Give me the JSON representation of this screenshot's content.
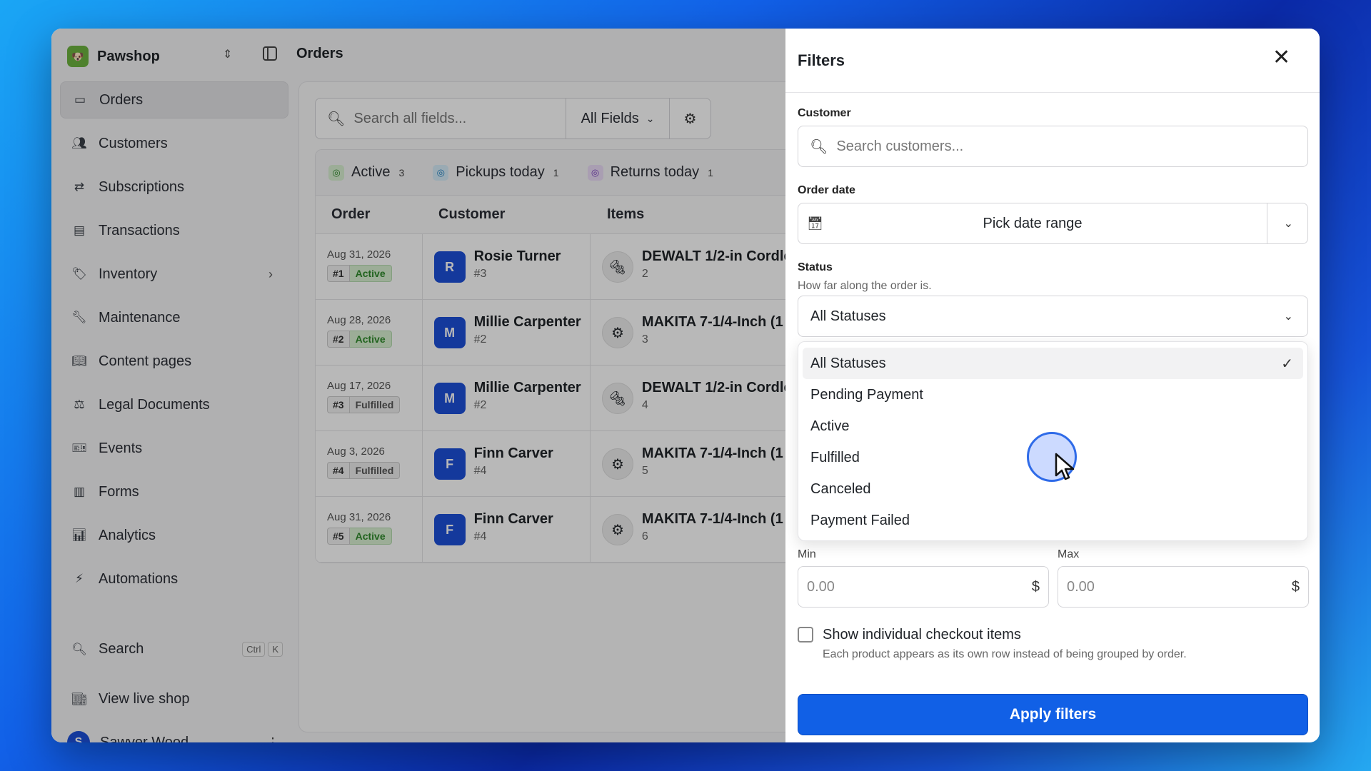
{
  "brand": {
    "name": "Pawshop",
    "logo_icon": "dog-logo-icon"
  },
  "topbar": {
    "title": "Orders"
  },
  "sidebar": {
    "items": [
      {
        "label": "Orders",
        "icon": "inbox-icon",
        "active": true
      },
      {
        "label": "Customers",
        "icon": "users-icon"
      },
      {
        "label": "Subscriptions",
        "icon": "repeat-icon"
      },
      {
        "label": "Transactions",
        "icon": "credit-card-icon"
      },
      {
        "label": "Inventory",
        "icon": "tag-icon",
        "has_chevron": true
      },
      {
        "label": "Maintenance",
        "icon": "wrench-icon"
      },
      {
        "label": "Content pages",
        "icon": "book-icon"
      },
      {
        "label": "Legal Documents",
        "icon": "scale-icon"
      },
      {
        "label": "Events",
        "icon": "ticket-icon"
      },
      {
        "label": "Forms",
        "icon": "form-icon"
      },
      {
        "label": "Analytics",
        "icon": "bar-chart-icon"
      },
      {
        "label": "Automations",
        "icon": "lightning-icon"
      }
    ],
    "search": {
      "label": "Search",
      "shortcut_ctrl": "Ctrl",
      "shortcut_key": "K"
    },
    "live_shop": {
      "label": "View live shop"
    },
    "user": {
      "initial": "S",
      "name": "Sawyer Wood"
    }
  },
  "main": {
    "search_placeholder": "Search all fields...",
    "field_select": "All Fields",
    "tabs": [
      {
        "label": "Active",
        "count": "3",
        "color": "#2f8a2a",
        "bg": "#d8f0d2"
      },
      {
        "label": "Pickups today",
        "count": "1",
        "color": "#1d7fbf",
        "bg": "#d6ecf8"
      },
      {
        "label": "Returns today",
        "count": "1",
        "color": "#7b3fbf",
        "bg": "#ebdcf7"
      }
    ],
    "columns": {
      "order": "Order",
      "customer": "Customer",
      "items": "Items"
    },
    "rows": [
      {
        "date": "Aug 31, 2026",
        "num": "#1",
        "status": "Active",
        "status_class": "active",
        "initial": "R",
        "customer": "Rosie Turner",
        "cust_id": "#3",
        "item": "DEWALT 1/2-in Cordle",
        "qty": "2",
        "item_icon": "drill-icon"
      },
      {
        "date": "Aug 28, 2026",
        "num": "#2",
        "status": "Active",
        "status_class": "active",
        "initial": "M",
        "customer": "Millie Carpenter",
        "cust_id": "#2",
        "item": "MAKITA 7-1/4-Inch (1",
        "qty": "3",
        "item_icon": "saw-icon"
      },
      {
        "date": "Aug 17, 2026",
        "num": "#3",
        "status": "Fulfilled",
        "status_class": "fulfilled",
        "initial": "M",
        "customer": "Millie Carpenter",
        "cust_id": "#2",
        "item": "DEWALT 1/2-in Cordle",
        "qty": "4",
        "item_icon": "drill-icon"
      },
      {
        "date": "Aug 3, 2026",
        "num": "#4",
        "status": "Fulfilled",
        "status_class": "fulfilled",
        "initial": "F",
        "customer": "Finn Carver",
        "cust_id": "#4",
        "item": "MAKITA 7-1/4-Inch (1",
        "qty": "5",
        "item_icon": "saw-icon"
      },
      {
        "date": "Aug 31, 2026",
        "num": "#5",
        "status": "Active",
        "status_class": "active",
        "initial": "F",
        "customer": "Finn Carver",
        "cust_id": "#4",
        "item": "MAKITA 7-1/4-Inch (1",
        "qty": "6",
        "item_icon": "saw-icon"
      }
    ]
  },
  "filters": {
    "title": "Filters",
    "customer_label": "Customer",
    "customer_placeholder": "Search customers...",
    "date_label": "Order date",
    "date_placeholder": "Pick date range",
    "status_label": "Status",
    "status_help": "How far along the order is.",
    "status_value": "All Statuses",
    "status_options": [
      "All Statuses",
      "Pending Payment",
      "Active",
      "Fulfilled",
      "Canceled",
      "Payment Failed"
    ],
    "min_label": "Min",
    "max_label": "Max",
    "min_placeholder": "0.00",
    "max_placeholder": "0.00",
    "currency": "$",
    "checkbox_label": "Show individual checkout items",
    "checkbox_desc": "Each product appears as its own row instead of being grouped by order.",
    "apply_label": "Apply filters",
    "accent": "#1160e6"
  }
}
